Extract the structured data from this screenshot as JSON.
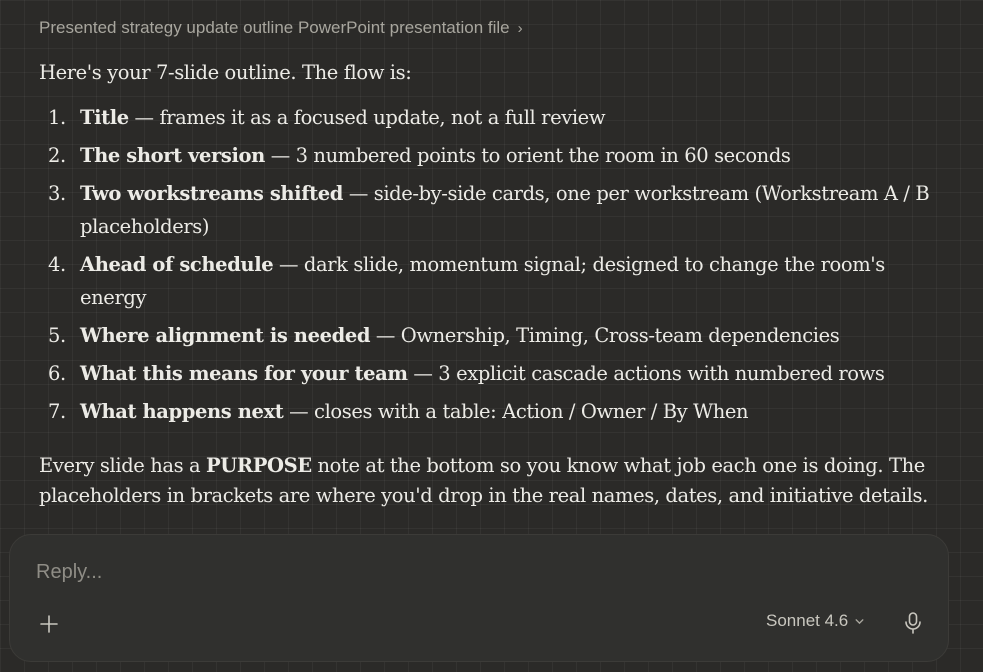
{
  "artifact": {
    "title": "Presented strategy update outline PowerPoint presentation file",
    "chevron": "›"
  },
  "message": {
    "intro": "Here's your 7-slide outline. The flow is:",
    "items": [
      {
        "num": "1.",
        "title": "Title",
        "text": " — frames it as a focused update, not a full review"
      },
      {
        "num": "2.",
        "title": "The short version",
        "text": " — 3 numbered points to orient the room in 60 seconds"
      },
      {
        "num": "3.",
        "title": "Two workstreams shifted",
        "text": " — side-by-side cards, one per workstream (Workstream A / B placeholders)"
      },
      {
        "num": "4.",
        "title": "Ahead of schedule",
        "text": " — dark slide, momentum signal; designed to change the room's energy"
      },
      {
        "num": "5.",
        "title": "Where alignment is needed",
        "text": " — Ownership, Timing, Cross-team dependencies"
      },
      {
        "num": "6.",
        "title": "What this means for your team",
        "text": " — 3 explicit cascade actions with numbered rows"
      },
      {
        "num": "7.",
        "title": "What happens next",
        "text": " — closes with a table: Action / Owner / By When"
      }
    ],
    "outro_pre": "Every slide has a ",
    "outro_bold": "PURPOSE",
    "outro_post": " note at the bottom so you know what job each one is doing. The placeholders in brackets are where you'd drop in the real names, dates, and initiative details."
  },
  "composer": {
    "placeholder": "Reply...",
    "model_label": "Sonnet 4.6",
    "model_chevron": "⌄"
  },
  "icons": {
    "plus": "plus-icon",
    "mic": "microphone-icon",
    "chevron": "chevron-right-icon"
  }
}
